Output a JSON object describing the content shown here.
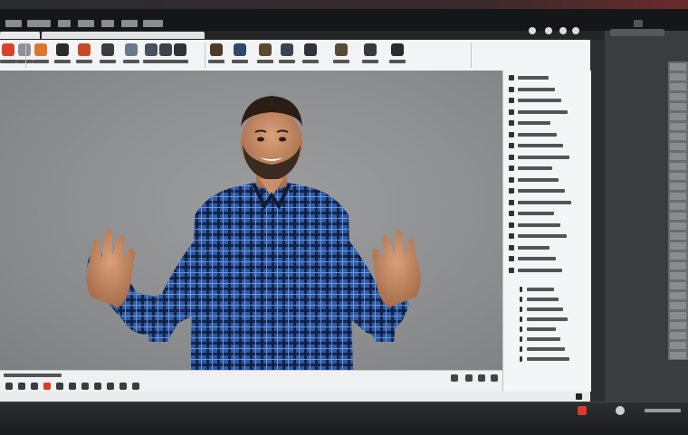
{
  "menubar": {
    "items": [
      "",
      "",
      "",
      "",
      "",
      ""
    ]
  },
  "tabs": [
    {
      "label": ""
    },
    {
      "label": ""
    }
  ],
  "toolbar": {
    "tools": [
      {
        "icon": "record-icon",
        "color": "#d9432c"
      },
      {
        "icon": "shape-icon",
        "color": "#8c9097"
      },
      {
        "icon": "palette-icon",
        "color": "#e0762e"
      },
      {
        "icon": "camera-icon",
        "color": "#2a2a2a"
      },
      {
        "icon": "material-icon",
        "color": "#c94a2a"
      },
      {
        "icon": "grid-icon",
        "color": "#3a3c40"
      },
      {
        "icon": "texture-icon",
        "color": "#6a7a8c"
      },
      {
        "icon": "layout-icon",
        "color": "#4a5060"
      },
      {
        "icon": "frame-icon",
        "color": "#3d4148"
      },
      {
        "icon": "panel-icon",
        "color": "#2f3338"
      },
      {
        "icon": "render-icon",
        "color": "#4c3a2a"
      },
      {
        "icon": "scene-icon",
        "color": "#2e4a6a"
      },
      {
        "icon": "light-icon",
        "color": "#5a4a30"
      },
      {
        "icon": "view-icon",
        "color": "#3a4450"
      },
      {
        "icon": "export-icon",
        "color": "#30343a"
      },
      {
        "icon": "image-icon",
        "color": "#5a4a3a"
      },
      {
        "icon": "film-icon",
        "color": "#3a3a3a"
      },
      {
        "icon": "output-icon",
        "color": "#2a2c30"
      }
    ]
  },
  "right_panel": {
    "rows": [
      "",
      "",
      "",
      "",
      "",
      "",
      "",
      "",
      "",
      "",
      "",
      "",
      "",
      "",
      "",
      "",
      "",
      ""
    ],
    "section2_rows": [
      "",
      "",
      "",
      "",
      "",
      "",
      "",
      ""
    ]
  },
  "bottombar": {
    "tools": [
      "",
      "",
      "",
      "",
      "",
      "",
      "",
      "",
      "",
      "",
      ""
    ]
  },
  "colors": {
    "accent": "#d93a2c",
    "shirt_blue": "#2d5aa8",
    "shirt_dark": "#0f1c3a",
    "skin": "#c98f6a"
  }
}
